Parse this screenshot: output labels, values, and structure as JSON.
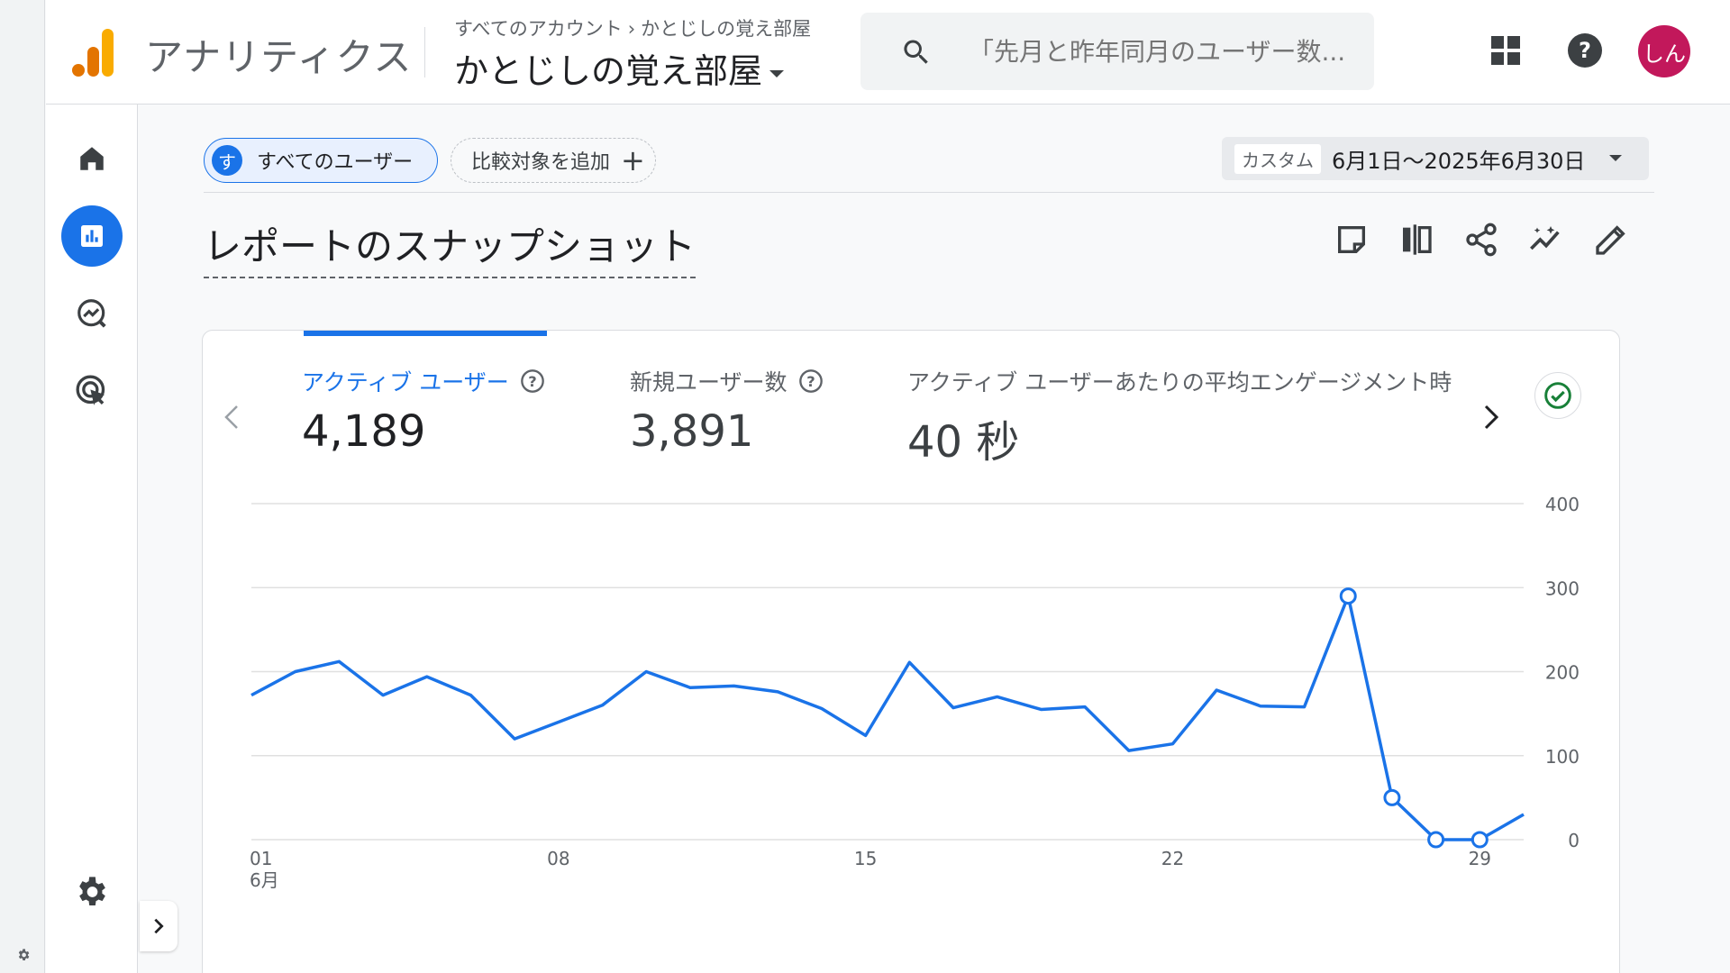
{
  "app": {
    "name": "アナリティクス"
  },
  "breadcrumb": {
    "account": "すべてのアカウント",
    "property": "かとじしの覚え部屋"
  },
  "property_selector": {
    "name": "かとじしの覚え部屋"
  },
  "search": {
    "placeholder": "「先月と昨年同月のユーザー数..."
  },
  "user": {
    "avatar_text": "しん",
    "avatar_color": "#c2185b"
  },
  "filters": {
    "segment_badge": "す",
    "segment_label": "すべてのユーザー",
    "compare_label": "比較対象を追加",
    "date_tag": "カスタム",
    "date_range": "6月1日～2025年6月30日"
  },
  "page": {
    "title": "レポートのスナップショット"
  },
  "metrics": [
    {
      "label": "アクティブ ユーザー",
      "value": "4,189"
    },
    {
      "label": "新規ユーザー数",
      "value": "3,891"
    },
    {
      "label": "アクティブ ユーザーあたりの平均エンゲージメント時",
      "value": "40 秒"
    }
  ],
  "colors": {
    "accent": "#1a73e8",
    "success": "#188038"
  },
  "chart_data": {
    "type": "line",
    "x_tick_labels": [
      "01",
      "08",
      "15",
      "22",
      "29"
    ],
    "x_month_label": "6月",
    "y_ticks": [
      0,
      100,
      200,
      300,
      400
    ],
    "ylim": [
      0,
      400
    ],
    "grid": true,
    "series": [
      {
        "x": [
          1,
          2,
          3,
          4,
          5,
          6,
          7,
          8,
          9,
          10,
          11,
          12,
          13,
          14,
          15,
          16,
          17,
          18,
          19,
          20,
          21,
          22,
          23,
          24,
          25,
          26,
          27,
          28,
          29,
          30
        ],
        "values": [
          172,
          200,
          212,
          172,
          194,
          172,
          120,
          140,
          160,
          200,
          181,
          183,
          176,
          156,
          124,
          211,
          157,
          170,
          155,
          158,
          106,
          114,
          178,
          159,
          158,
          290,
          50,
          0,
          0,
          30
        ],
        "highlighted_x": [
          26,
          27,
          28,
          29
        ]
      }
    ]
  }
}
